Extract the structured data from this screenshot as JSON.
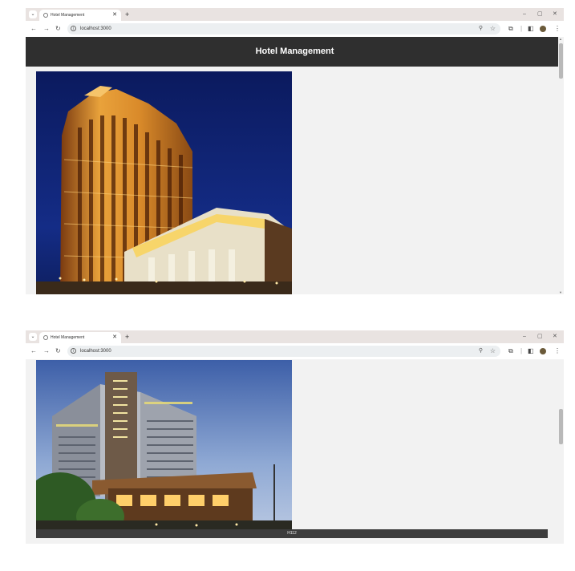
{
  "browser": {
    "tab_title": "Hotel Management",
    "tab_close": "✕",
    "new_tab": "+",
    "url": "localhost:3000",
    "window_controls": [
      "–",
      "▢",
      "✕"
    ],
    "nav": {
      "back": "←",
      "forward": "→",
      "reload": "↻"
    }
  },
  "page": {
    "header_title": "Hotel Management",
    "cards": [
      {
        "caption": ""
      },
      {
        "caption": "H112"
      }
    ]
  },
  "colors": {
    "header_bg": "#2f2f2f",
    "page_bg": "#f2f2f2",
    "caption_bg": "#3d3d3d"
  }
}
